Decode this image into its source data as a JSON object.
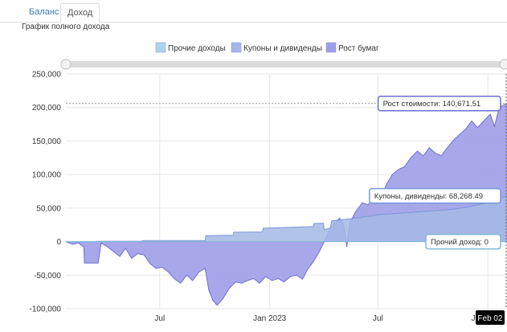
{
  "tabs": [
    {
      "label": "Баланс",
      "active": false
    },
    {
      "label": "Доход",
      "active": true
    }
  ],
  "subtitle": "График полного дохода",
  "colors": {
    "other": "#a8d5ea",
    "coupons": "#a4b8e6",
    "growth": "#9e9de8",
    "growth_line": "#6f6fd6",
    "coupons_line": "#7b96da",
    "grid": "#e6e6e6",
    "accent": "#337ab7"
  },
  "chart_data": {
    "type": "area",
    "stacked": true,
    "legend": [
      "Прочие доходы",
      "Купоны и дивиденды",
      "Рост бумаг"
    ],
    "legend_position": "top-center",
    "x_start": "2022-01-25",
    "x_end": "2024-02-02",
    "ylim": [
      -100000,
      250000
    ],
    "yticks": [
      250000,
      200000,
      150000,
      100000,
      50000,
      0,
      -50000,
      -100000
    ],
    "ytick_labels": [
      "250,000",
      "200,000",
      "150,000",
      "100,000",
      "50,000",
      "0",
      "-50,000",
      "-100,000"
    ],
    "xticks": [
      {
        "date": "2022-07-01",
        "label": "Jul"
      },
      {
        "date": "2023-01-01",
        "label": "Jan 2023"
      },
      {
        "date": "2023-07-01",
        "label": "Jul"
      },
      {
        "date": "2024-01-01",
        "label": "Jan 2024"
      }
    ],
    "grid": true,
    "series": [
      {
        "name": "Прочие доходы",
        "points": [
          [
            "2022-01-25",
            0
          ],
          [
            "2024-02-02",
            0
          ]
        ]
      },
      {
        "name": "Купоны и дивиденды",
        "points": [
          [
            "2022-01-25",
            0
          ],
          [
            "2022-03-15",
            0
          ],
          [
            "2022-03-16",
            500
          ],
          [
            "2022-06-01",
            700
          ],
          [
            "2022-06-02",
            1500
          ],
          [
            "2022-09-15",
            1600
          ],
          [
            "2022-09-16",
            9000
          ],
          [
            "2022-11-01",
            9500
          ],
          [
            "2022-11-02",
            14000
          ],
          [
            "2022-12-20",
            14500
          ],
          [
            "2022-12-21",
            20000
          ],
          [
            "2023-03-15",
            22500
          ],
          [
            "2023-03-16",
            27000
          ],
          [
            "2023-04-01",
            27500
          ],
          [
            "2023-04-02",
            18000
          ],
          [
            "2023-04-12",
            20000
          ],
          [
            "2023-04-15",
            31000
          ],
          [
            "2023-05-15",
            34000
          ],
          [
            "2023-06-01",
            36000
          ],
          [
            "2023-06-15",
            38000
          ],
          [
            "2023-07-01",
            40000
          ],
          [
            "2023-08-01",
            42000
          ],
          [
            "2023-09-01",
            44000
          ],
          [
            "2023-10-01",
            46000
          ],
          [
            "2023-11-01",
            48000
          ],
          [
            "2023-12-01",
            52000
          ],
          [
            "2023-12-15",
            55000
          ],
          [
            "2024-01-01",
            58000
          ],
          [
            "2024-01-15",
            63000
          ],
          [
            "2024-02-02",
            68268.49
          ]
        ]
      },
      {
        "name": "Рост бумаг",
        "points": [
          [
            "2022-01-25",
            0
          ],
          [
            "2022-02-05",
            -4000
          ],
          [
            "2022-02-15",
            -2000
          ],
          [
            "2022-02-24",
            -8000
          ],
          [
            "2022-02-25",
            -32000
          ],
          [
            "2022-03-20",
            -32000
          ],
          [
            "2022-03-25",
            -2000
          ],
          [
            "2022-04-05",
            -8000
          ],
          [
            "2022-04-15",
            -15000
          ],
          [
            "2022-04-25",
            -22000
          ],
          [
            "2022-05-05",
            -10000
          ],
          [
            "2022-05-15",
            -25000
          ],
          [
            "2022-05-25",
            -18000
          ],
          [
            "2022-06-05",
            -20000
          ],
          [
            "2022-06-15",
            -33000
          ],
          [
            "2022-06-25",
            -40000
          ],
          [
            "2022-07-05",
            -38000
          ],
          [
            "2022-07-15",
            -45000
          ],
          [
            "2022-07-25",
            -55000
          ],
          [
            "2022-08-05",
            -62000
          ],
          [
            "2022-08-15",
            -50000
          ],
          [
            "2022-08-25",
            -58000
          ],
          [
            "2022-09-05",
            -45000
          ],
          [
            "2022-09-15",
            -40000
          ],
          [
            "2022-09-21",
            -72000
          ],
          [
            "2022-09-28",
            -88000
          ],
          [
            "2022-10-05",
            -95000
          ],
          [
            "2022-10-15",
            -85000
          ],
          [
            "2022-10-25",
            -70000
          ],
          [
            "2022-11-05",
            -60000
          ],
          [
            "2022-11-15",
            -62000
          ],
          [
            "2022-11-25",
            -58000
          ],
          [
            "2022-12-05",
            -55000
          ],
          [
            "2022-12-15",
            -62000
          ],
          [
            "2022-12-25",
            -52000
          ],
          [
            "2023-01-05",
            -58000
          ],
          [
            "2023-01-15",
            -55000
          ],
          [
            "2023-01-25",
            -60000
          ],
          [
            "2023-02-05",
            -52000
          ],
          [
            "2023-02-15",
            -50000
          ],
          [
            "2023-02-25",
            -56000
          ],
          [
            "2023-03-05",
            -42000
          ],
          [
            "2023-03-15",
            -30000
          ],
          [
            "2023-03-25",
            -15000
          ],
          [
            "2023-04-05",
            5000
          ],
          [
            "2023-04-12",
            20000
          ],
          [
            "2023-04-20",
            28000
          ],
          [
            "2023-04-28",
            35000
          ],
          [
            "2023-05-05",
            25000
          ],
          [
            "2023-05-10",
            -8000
          ],
          [
            "2023-05-15",
            28000
          ],
          [
            "2023-05-25",
            45000
          ],
          [
            "2023-06-05",
            58000
          ],
          [
            "2023-06-15",
            55000
          ],
          [
            "2023-06-25",
            68000
          ],
          [
            "2023-07-05",
            62000
          ],
          [
            "2023-07-15",
            85000
          ],
          [
            "2023-07-25",
            100000
          ],
          [
            "2023-08-05",
            108000
          ],
          [
            "2023-08-15",
            112000
          ],
          [
            "2023-08-25",
            125000
          ],
          [
            "2023-09-05",
            135000
          ],
          [
            "2023-09-15",
            128000
          ],
          [
            "2023-09-25",
            140000
          ],
          [
            "2023-10-05",
            132000
          ],
          [
            "2023-10-15",
            128000
          ],
          [
            "2023-10-25",
            140000
          ],
          [
            "2023-11-05",
            152000
          ],
          [
            "2023-11-15",
            160000
          ],
          [
            "2023-11-25",
            168000
          ],
          [
            "2023-12-05",
            180000
          ],
          [
            "2023-12-15",
            170000
          ],
          [
            "2023-12-25",
            180000
          ],
          [
            "2024-01-05",
            190000
          ],
          [
            "2024-01-12",
            172000
          ],
          [
            "2024-01-20",
            200000
          ],
          [
            "2024-01-28",
            204000
          ],
          [
            "2024-02-02",
            206000
          ]
        ]
      }
    ],
    "tooltips": [
      {
        "label": "Рост стоимости: 140,671.51",
        "value": 206000
      },
      {
        "label": "Купоны, дивиденды: 68,268.49",
        "value": 68268.49
      },
      {
        "label": "Прочий доход: 0",
        "value": 0
      }
    ],
    "crosshair_label": "Feb 02"
  }
}
